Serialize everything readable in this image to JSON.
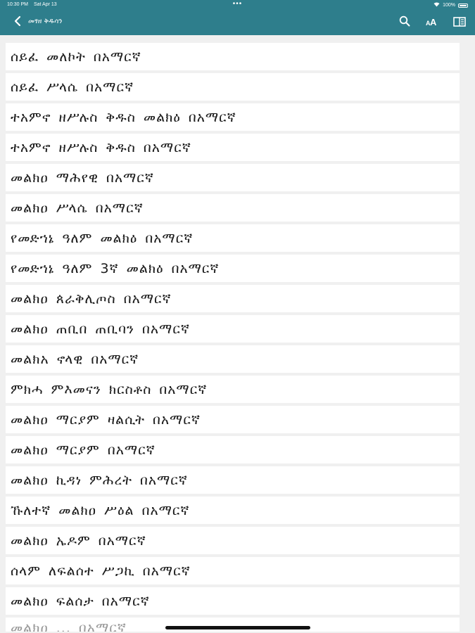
{
  "status_bar": {
    "time": "10:30 PM",
    "date": "Sat Apr 13",
    "dots": "•••",
    "battery": "100%"
  },
  "nav": {
    "title": "መፃዘ ቅዱሳን",
    "accent_color": "#2e7e8c",
    "icons": [
      "chevron-left-icon",
      "search-icon",
      "font-size-icon",
      "book-icon"
    ]
  },
  "list": {
    "items": [
      "ሰይፈ መለኮት በአማርኛ",
      "ሰይፈ ሥላሴ በአማርኛ",
      "ተአምኖ ዘሥሉስ ቅዱስ መልክዕ በአማርኛ",
      "ተአምኖ ዘሥሉስ ቅዱስ በአማርኛ",
      "መልክዐ ማሕየዊ በአማርኛ",
      "መልክዐ ሥላሴ በአማርኛ",
      "የመድኀኔ ዓለም መልክዕ በአማርኛ",
      "የመድኀኔ ዓለም 3ኛ መልክዕ በአማርኛ",
      "መልክዐ ጰራቅሊጦስ በአማርኛ",
      "መልክዐ ጠቢበ ጠቢባን በአማርኛ",
      "መልክአ ኖላዊ በአማርኛ",
      "ምክሓ ምእመናን ክርስቶስ በአማርኛ",
      "መልክዐ ማርያም ዛልሲት በአማርኛ",
      "መልክዐ ማርያም በአማርኛ",
      "መልክዐ ኪዳነ ምሕረት በአማርኛ",
      "ኹለተኛ መልክዐ ሥዕል በአማርኛ",
      "መልክዐ ኤዶም በአማርኛ",
      "ሰላም ለፍልሰተ ሥጋኪ በአማርኛ",
      "መልክዐ ፍልሰታ በአማርኛ"
    ],
    "partial_item": "መልክዐ ... በአማርኛ"
  }
}
